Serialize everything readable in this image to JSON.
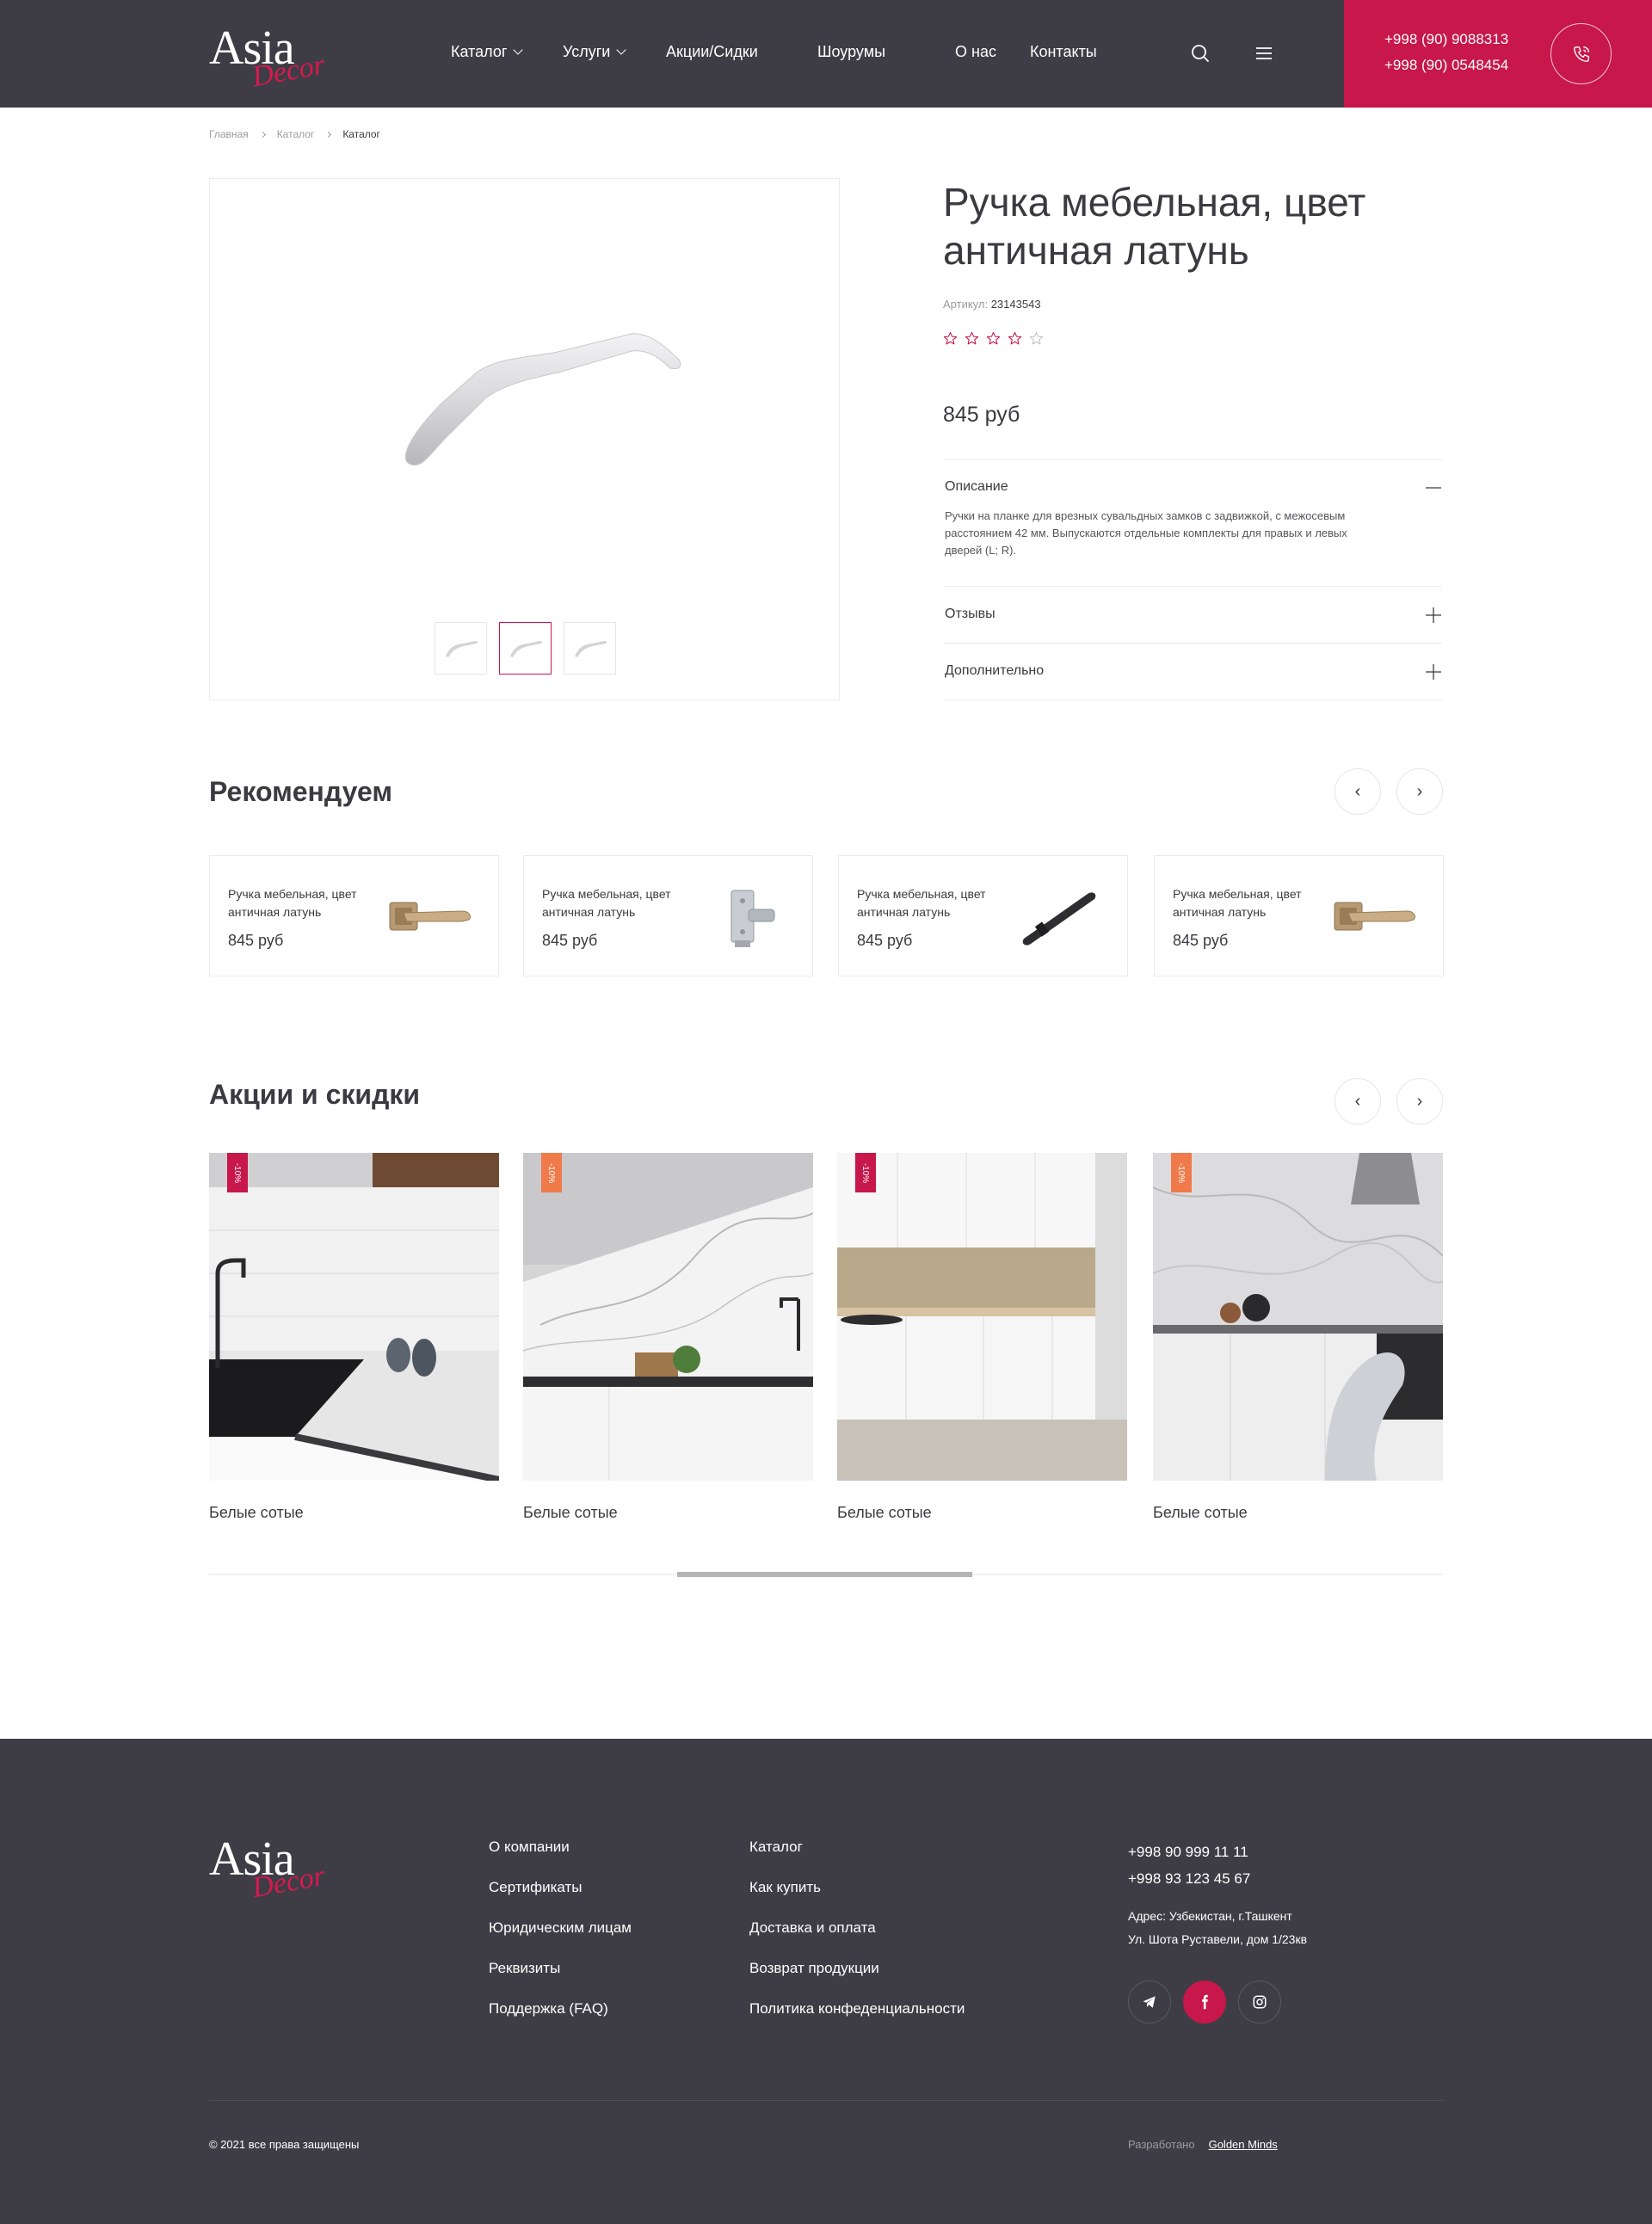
{
  "brand": {
    "logo_word1": "Asia",
    "logo_word2": "Decor",
    "accent_color": "#c7174b",
    "header_bg": "#3e3d45"
  },
  "nav": {
    "items": [
      {
        "label": "Каталог",
        "has_dropdown": true
      },
      {
        "label": "Услуги",
        "has_dropdown": true
      },
      {
        "label": "Акции/Сидки"
      },
      {
        "label": "Шоурумы"
      },
      {
        "label": "О нас"
      },
      {
        "label": "Контакты"
      }
    ],
    "search_icon": "search-icon",
    "menu_icon": "hamburger-icon"
  },
  "header_phones": [
    "+998 (90) 9088313",
    "+998 (90) 0548454"
  ],
  "breadcrumb": [
    "Главная",
    "Каталог",
    "Каталог"
  ],
  "product": {
    "title": "Ручка мебельная, цвет античная латунь",
    "sku_label": "Артикул:",
    "sku": "23143543",
    "rating": 4,
    "rating_max": 5,
    "price": "845 руб",
    "thumbnails_count": 3,
    "active_thumbnail": 2,
    "accordion": [
      {
        "title": "Описание",
        "open": true,
        "body": "Ручки на планке для врезных сувальдных замков с задвижкой, с межосевым расстоянием 42 мм. Выпускаются отдельные комплекты для правых и левых дверей (L; R)."
      },
      {
        "title": "Отзывы",
        "open": false
      },
      {
        "title": "Дополнительно",
        "open": false
      }
    ]
  },
  "recommend": {
    "title": "Рекомендуем",
    "items": [
      {
        "name": "Ручка мебельная, цвет античная латунь",
        "price": "845 руб",
        "image": "brass-lever-handle"
      },
      {
        "name": "Ручка мебельная, цвет античная латунь",
        "price": "845 руб",
        "image": "chrome-latch"
      },
      {
        "name": "Ручка мебельная, цвет античная латунь",
        "price": "845 руб",
        "image": "black-bar-handle"
      },
      {
        "name": "Ручка мебельная, цвет античная латунь",
        "price": "845 руб",
        "image": "brass-lever-handle"
      }
    ]
  },
  "promo": {
    "title": "Акции и скидки",
    "items": [
      {
        "name": "Белые сотые",
        "badge": "-10%",
        "badge_color": "#c7174b"
      },
      {
        "name": "Белые сотые",
        "badge": "-10%",
        "badge_color": "#f07a4a"
      },
      {
        "name": "Белые сотые",
        "badge": "-10%",
        "badge_color": "#c7174b"
      },
      {
        "name": "Белые сотые",
        "badge": "-10%",
        "badge_color": "#f07a4a"
      }
    ]
  },
  "footer": {
    "col1": [
      "О компании",
      "Сертификаты",
      "Юридическим лицам",
      "Реквизиты",
      "Поддержка (FAQ)"
    ],
    "col2": [
      "Каталог",
      "Как купить",
      "Доставка и оплата",
      "Возврат продукции",
      "Политика конфеденциальности"
    ],
    "phones": [
      "+998 90 999 11 11",
      "+998 93 123 45 67"
    ],
    "address_line1": "Адрес: Узбекистан, г.Ташкент",
    "address_line2": "Ул. Шота Руставели, дом 1/23кв",
    "socials": [
      "telegram-icon",
      "facebook-icon",
      "instagram-icon"
    ],
    "copyright": "© 2021 все права защищены",
    "dev_label": "Разработано",
    "dev_name": "Golden Minds"
  }
}
